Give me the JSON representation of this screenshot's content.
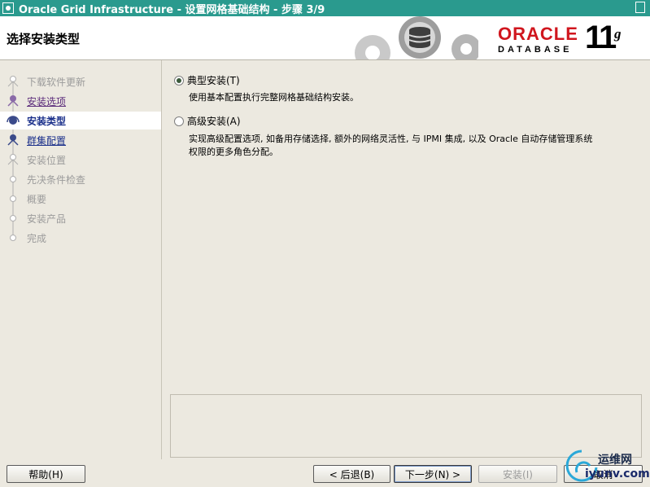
{
  "window": {
    "title": "Oracle Grid Infrastructure - 设置网格基础结构 - 步骤 3/9"
  },
  "header": {
    "page_title": "选择安装类型",
    "logo_brand": "ORACLE",
    "logo_product": "DATABASE",
    "logo_version": "11",
    "logo_version_suffix": "g"
  },
  "steps": [
    {
      "label": "下载软件更新",
      "state": "disabled"
    },
    {
      "label": "安装选项",
      "state": "visited"
    },
    {
      "label": "安装类型",
      "state": "current"
    },
    {
      "label": "群集配置",
      "state": "link"
    },
    {
      "label": "安装位置",
      "state": "disabled"
    },
    {
      "label": "先决条件检查",
      "state": "disabled"
    },
    {
      "label": "概要",
      "state": "disabled"
    },
    {
      "label": "安装产品",
      "state": "disabled"
    },
    {
      "label": "完成",
      "state": "disabled"
    }
  ],
  "options": {
    "typical": {
      "label": "典型安装(T)",
      "selected": true,
      "description": "使用基本配置执行完整网格基础结构安装。"
    },
    "advanced": {
      "label": "高级安装(A)",
      "selected": false,
      "description_line1": "实现高级配置选项, 如备用存储选择, 额外的网络灵活性, 与 IPMI 集成, 以及 Oracle 自动存储管理系统",
      "description_line2": "权限的更多角色分配。"
    }
  },
  "buttons": {
    "help": "帮助(H)",
    "back": "< 后退(B)",
    "next": "下一步(N) >",
    "install": "安装(I)",
    "cancel": "取消"
  },
  "watermark": {
    "line1": "运维网",
    "line2": "iyunv.com"
  },
  "colors": {
    "titlebar": "#2a9a8e",
    "oracle_red": "#d0161e",
    "background": "#ece9e0"
  }
}
